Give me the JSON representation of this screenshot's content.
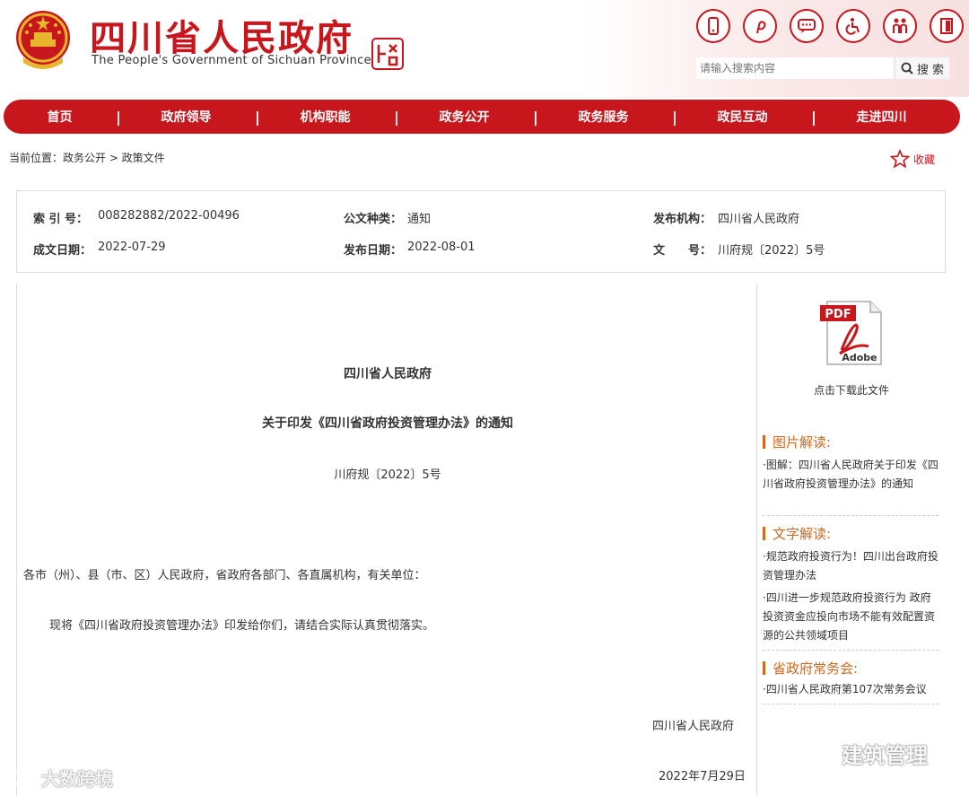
{
  "header": {
    "title": "四川省人民政府",
    "subtitle": "The People's Government of Sichuan Province",
    "seal_text": "中國四川",
    "icons": [
      "mobile-icon",
      "weibo-icon",
      "wechat-icon",
      "accessibility-icon",
      "elderly-care-icon",
      "exit-icon"
    ]
  },
  "search": {
    "placeholder": "请输入搜索内容",
    "button_label": "搜 索"
  },
  "nav": {
    "items": [
      "首页",
      "政府领导",
      "机构职能",
      "政务公开",
      "政务服务",
      "政民互动",
      "走进四川"
    ],
    "separator": "|"
  },
  "breadcrumb": "当前位置：政务公开 > 政策文件",
  "favorite_label": "收藏",
  "meta": {
    "index_label": "索 引 号：",
    "index_value": "008282882/2022-00496",
    "type_label": "公文种类：",
    "type_value": "通知",
    "issuer_label": "发布机构：",
    "issuer_value": "四川省人民政府",
    "written_label": "成文日期：",
    "written_value": "2022-07-29",
    "published_label": "发布日期：",
    "published_value": "2022-08-01",
    "docno_label": "文　　号：",
    "docno_value": "川府规〔2022〕5号"
  },
  "document": {
    "org": "四川省人民政府",
    "title": "关于印发《四川省政府投资管理办法》的通知",
    "number": "川府规〔2022〕5号",
    "addressee": "各市（州）、县（市、区）人民政府，省政府各部门、各直属机构，有关单位：",
    "body": "现将《四川省政府投资管理办法》印发给你们，请结合实际认真贯彻落实。",
    "signature": "四川省人民政府",
    "date": "2022年7月29日"
  },
  "sidebar": {
    "pdf_label": "PDF",
    "pdf_brand": "Adobe",
    "download_label": "点击下载此文件",
    "sections": [
      {
        "heading": "图片解读:",
        "items": [
          "·图解：四川省人民政府关于印发《四川省政府投资管理办法》的通知"
        ]
      },
      {
        "heading": "文字解读:",
        "items": [
          "·规范政府投资行为！四川出台政府投资管理办法",
          "·四川进一步规范政府投资行为 政府投资资金应投向市场不能有效配置资源的公共领域项目"
        ]
      },
      {
        "heading": "省政府常务会:",
        "items": [
          "·四川省人民政府第107次常务会议"
        ]
      }
    ]
  },
  "watermarks": {
    "left": "大数跨境",
    "right": "建筑管理"
  },
  "colors": {
    "brand_red": "#c8161d",
    "section_orange": "#d2691e"
  }
}
